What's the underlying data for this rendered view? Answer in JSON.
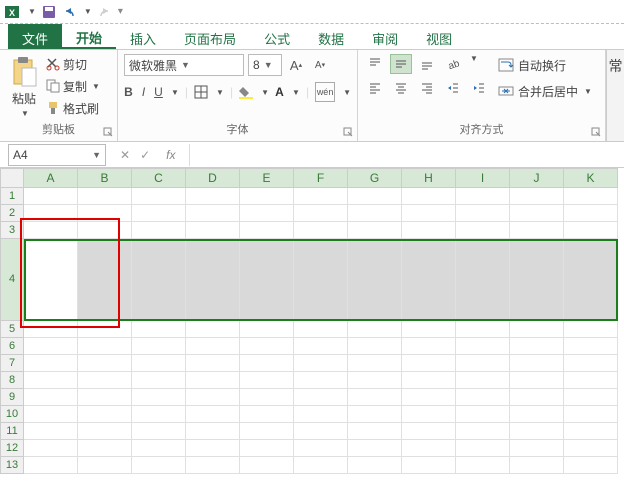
{
  "qat": {
    "save_title": "保存",
    "undo_title": "撤销",
    "redo_title": "重做"
  },
  "tabs": {
    "file": "文件",
    "home": "开始",
    "insert": "插入",
    "layout": "页面布局",
    "formulas": "公式",
    "data": "数据",
    "review": "审阅",
    "view": "视图"
  },
  "clipboard": {
    "paste": "粘贴",
    "cut": "剪切",
    "copy": "复制",
    "formatpainter": "格式刷",
    "group": "剪贴板"
  },
  "font": {
    "name": "微软雅黑",
    "size": "8",
    "group": "字体",
    "increase": "A",
    "decrease": "A",
    "wen": "wén"
  },
  "align": {
    "group": "对齐方式",
    "wrap": "自动换行",
    "merge": "合并后居中"
  },
  "right_edge": "常",
  "namebox": "A4",
  "fx": "fx",
  "columns": [
    "A",
    "B",
    "C",
    "D",
    "E",
    "F",
    "G",
    "H",
    "I",
    "J",
    "K"
  ],
  "rows": [
    "1",
    "2",
    "3",
    "4",
    "5",
    "6",
    "7",
    "8",
    "9",
    "10",
    "11",
    "12",
    "13"
  ]
}
